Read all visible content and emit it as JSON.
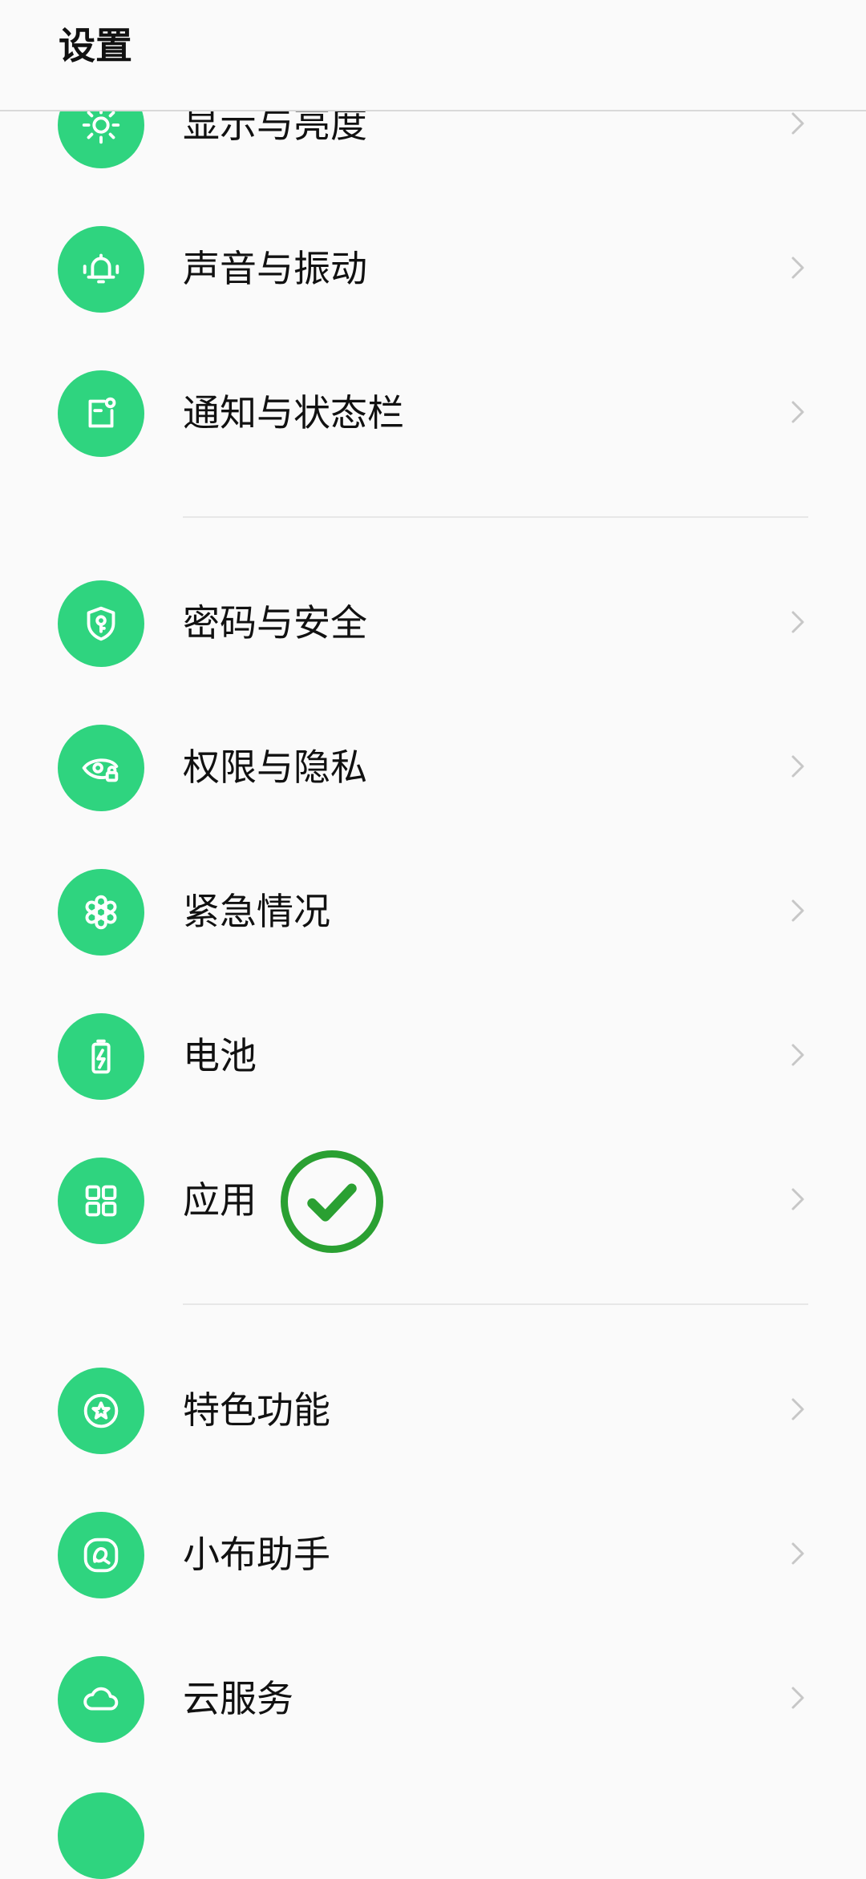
{
  "header": {
    "title": "设置"
  },
  "settings": {
    "display": "显示与亮度",
    "sound": "声音与振动",
    "notifications": "通知与状态栏",
    "password": "密码与安全",
    "privacy": "权限与隐私",
    "emergency": "紧急情况",
    "battery": "电池",
    "apps": "应用",
    "features": "特色功能",
    "assistant": "小布助手",
    "cloud": "云服务"
  },
  "colors": {
    "icon_bg": "#2fd47f",
    "check": "#2aa032",
    "chevron": "#c7c7c7"
  },
  "icons": {
    "display": "sun-icon",
    "sound": "bell-icon",
    "notifications": "notification-icon",
    "password": "shield-key-icon",
    "privacy": "eye-lock-icon",
    "emergency": "asterisk-icon",
    "battery": "battery-icon",
    "apps": "grid-icon",
    "features": "star-circle-icon",
    "assistant": "assistant-icon",
    "cloud": "cloud-icon",
    "check": "checkmark-circle-icon"
  }
}
